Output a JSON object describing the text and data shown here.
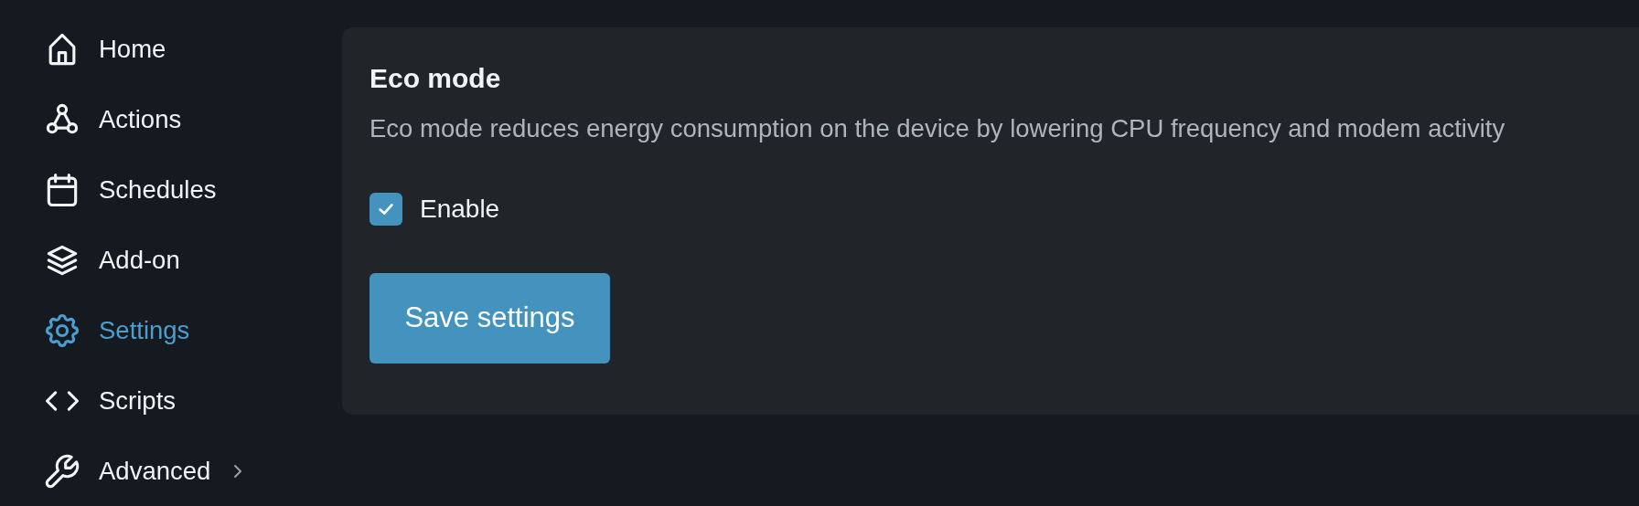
{
  "sidebar": {
    "items": [
      {
        "kind": "home",
        "label": "Home",
        "selected": false,
        "expandable": false
      },
      {
        "kind": "webhook",
        "label": "Actions",
        "selected": false,
        "expandable": false
      },
      {
        "kind": "calendar",
        "label": "Schedules",
        "selected": false,
        "expandable": false
      },
      {
        "kind": "layers",
        "label": "Add-on",
        "selected": false,
        "expandable": false
      },
      {
        "kind": "gear",
        "label": "Settings",
        "selected": true,
        "expandable": false
      },
      {
        "kind": "code",
        "label": "Scripts",
        "selected": false,
        "expandable": false
      },
      {
        "kind": "wrench",
        "label": "Advanced",
        "selected": false,
        "expandable": true
      }
    ]
  },
  "card": {
    "title": "Eco mode",
    "description": "Eco mode reduces energy consumption on the device by lowering CPU frequency and modem activity",
    "checkbox": {
      "label": "Enable",
      "checked": true
    },
    "button": "Save settings"
  }
}
